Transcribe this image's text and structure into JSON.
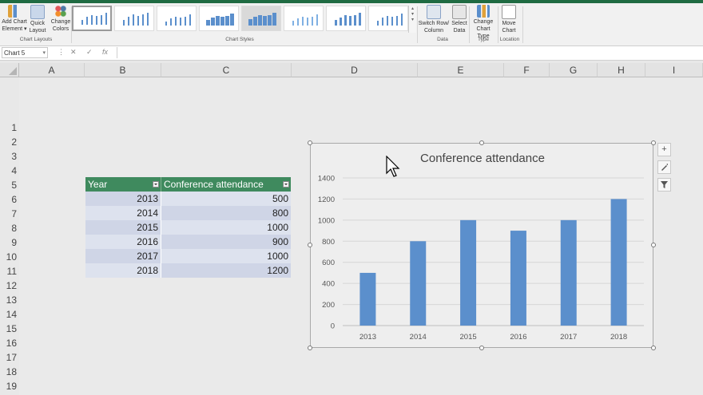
{
  "ribbon": {
    "add_chart_element": "Add Chart Element",
    "quick_layout": "Quick Layout",
    "change_colors": "Change Colors",
    "chart_layouts_label": "Chart Layouts",
    "chart_styles_label": "Chart Styles",
    "switch_row_column": "Switch Row/ Column",
    "select_data": "Select Data",
    "data_label": "Data",
    "change_chart_type": "Change Chart Type",
    "type_label": "Type",
    "move_chart": "Move Chart",
    "location_label": "Location"
  },
  "formula_bar": {
    "name_box": "Chart 5",
    "cancel_icon": "✕",
    "enter_icon": "✓",
    "fx": "fx"
  },
  "columns": [
    "A",
    "B",
    "C",
    "D",
    "E",
    "F",
    "G",
    "H",
    "I"
  ],
  "rows": [
    "1",
    "2",
    "3",
    "4",
    "5",
    "6",
    "7",
    "8",
    "9",
    "10",
    "11",
    "12",
    "13",
    "14",
    "15",
    "16",
    "17",
    "18",
    "19"
  ],
  "table": {
    "headers": [
      "Year",
      "Conference attendance"
    ],
    "rows": [
      [
        "2013",
        "500"
      ],
      [
        "2014",
        "800"
      ],
      [
        "2015",
        "1000"
      ],
      [
        "2016",
        "900"
      ],
      [
        "2017",
        "1000"
      ],
      [
        "2018",
        "1200"
      ]
    ]
  },
  "chart_data": {
    "type": "bar",
    "title": "Conference attendance",
    "categories": [
      "2013",
      "2014",
      "2015",
      "2016",
      "2017",
      "2018"
    ],
    "values": [
      500,
      800,
      1000,
      900,
      1000,
      1200
    ],
    "ylim": [
      0,
      1400
    ],
    "yticks": [
      "0",
      "200",
      "400",
      "600",
      "800",
      "1000",
      "1200",
      "1400"
    ],
    "grid": true,
    "bar_color": "#5b8fcc"
  },
  "chart_side_buttons": {
    "add": "+",
    "style": "brush-icon",
    "filter": "filter-icon"
  },
  "colors": {
    "table_header": "#3f8a5e",
    "accent_green": "#1f6b42"
  }
}
